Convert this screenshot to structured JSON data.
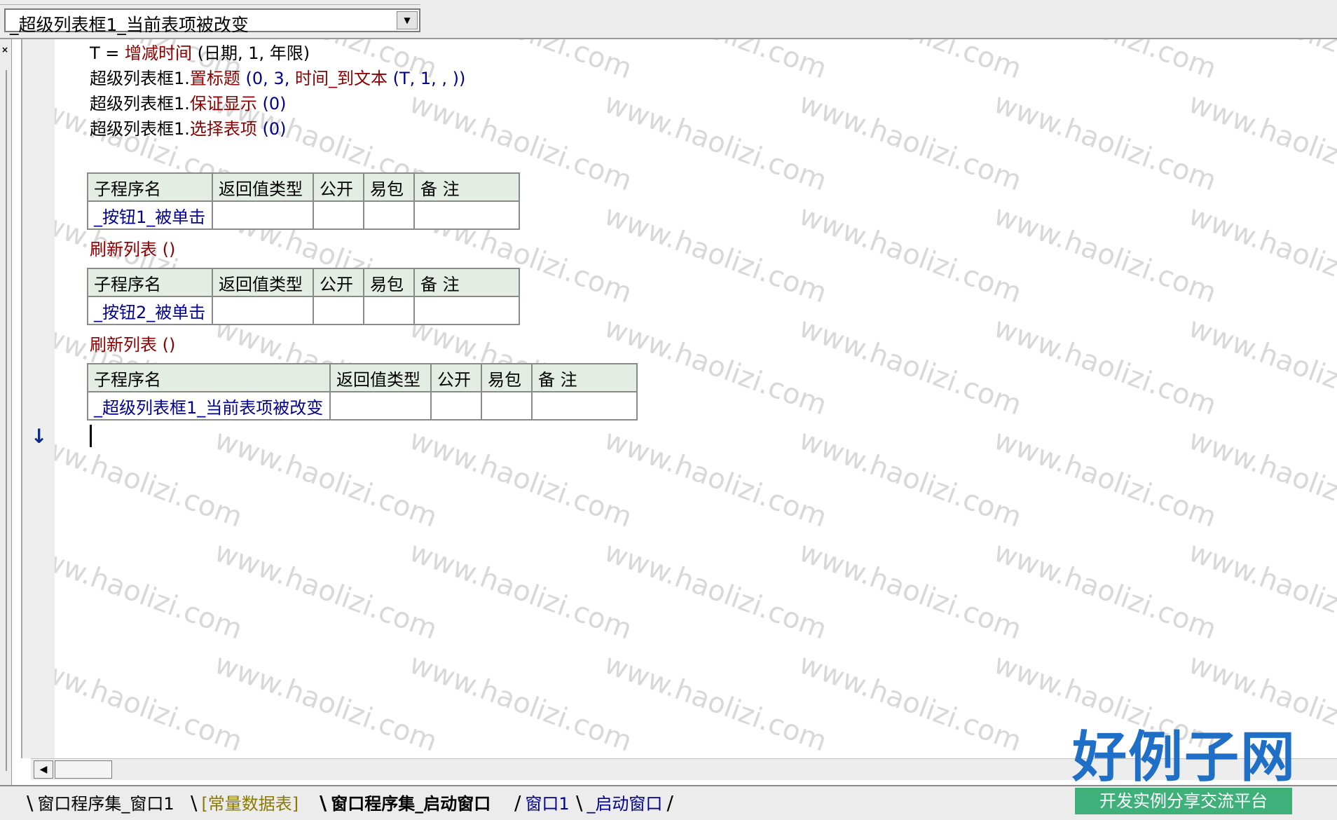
{
  "header": {
    "combo_value": "_超级列表框1_当前表项被改变",
    "combo_arrow": "▼"
  },
  "left": {
    "close_label": "×",
    "gutter_arrow": "↓"
  },
  "code": {
    "line1": {
      "a": "T = ",
      "b": "增减时间",
      "c": " (日期, 1, 年限)"
    },
    "line2": {
      "a": "超级列表框1.",
      "b": "置标题",
      "c": " (0, 3, ",
      "d": "时间_到文本",
      "e": " (T, 1, , ))"
    },
    "line3": {
      "a": "超级列表框1.",
      "b": "保证显示",
      "c": " (0)"
    },
    "line4": {
      "a": "超级列表框1.",
      "b": "选择表项",
      "c": " (0)"
    },
    "refresh1": "刷新列表 ()",
    "refresh2": "刷新列表 ()"
  },
  "table_headers": [
    "子程序名",
    "返回值类型",
    "公开",
    "易包",
    "备 注"
  ],
  "subs": [
    {
      "name": "_按钮1_被单击"
    },
    {
      "name": "_按钮2_被单击"
    },
    {
      "name": "_超级列表框1_当前表项被改变"
    }
  ],
  "tabs": [
    {
      "label": "窗口程序集_窗口1",
      "color": "#000000"
    },
    {
      "label": "[常量数据表]",
      "color": "#8b7a00"
    },
    {
      "label": "窗口程序集_启动窗口",
      "color": "#000000"
    },
    {
      "label": "窗口1",
      "color": "#00008b"
    },
    {
      "label": "_启动窗口",
      "color": "#00008b"
    }
  ],
  "scroll": {
    "left_arrow": "◀"
  },
  "watermark": "www.haolizi.com",
  "logo": {
    "title": "好例子网",
    "subtitle": "开发实例分享交流平台"
  }
}
